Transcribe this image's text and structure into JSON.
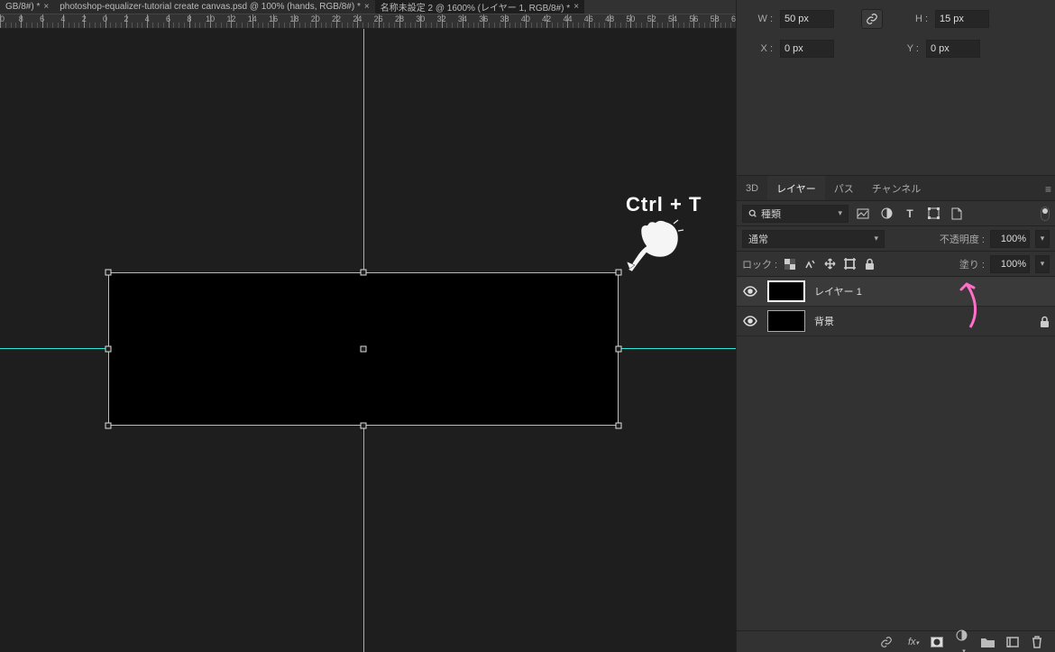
{
  "tabs": [
    {
      "label": "GB/8#) *"
    },
    {
      "label": "photoshop-equalizer-tutorial create canvas.psd @ 100% (hands, RGB/8#) *"
    },
    {
      "label": "名称未設定 2 @ 1600% (レイヤー 1, RGB/8#) *"
    }
  ],
  "ruler_start": -10,
  "ruler_end": 60,
  "ruler_step": 2,
  "hint": "Ctrl + T",
  "props": {
    "w_label": "W :",
    "w_value": "50 px",
    "h_label": "H :",
    "h_value": "15 px",
    "x_label": "X :",
    "x_value": "0 px",
    "y_label": "Y :",
    "y_value": "0 px"
  },
  "panel_tabs": {
    "threeD": "3D",
    "layers": "レイヤー",
    "paths": "パス",
    "channels": "チャンネル"
  },
  "filter": {
    "kind": "種類"
  },
  "blend": {
    "mode": "通常",
    "opacity_label": "不透明度 :",
    "opacity": "100%"
  },
  "fill": {
    "lock_label": "ロック :",
    "fill_label": "塗り :",
    "fill": "100%"
  },
  "layers": [
    {
      "name": "レイヤー 1",
      "selected": true,
      "locked": false
    },
    {
      "name": "背景",
      "selected": false,
      "locked": true
    }
  ]
}
